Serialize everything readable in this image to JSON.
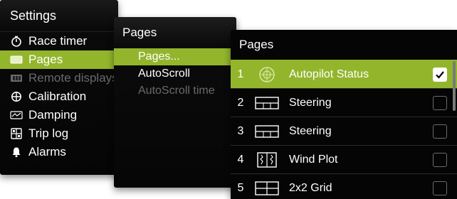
{
  "settings": {
    "title": "Settings",
    "items": [
      {
        "label": "Race timer",
        "icon": "stopwatch-icon"
      },
      {
        "label": "Pages",
        "icon": "pages-icon",
        "selected": true
      },
      {
        "label": "Remote displays",
        "icon": "remote-display-icon",
        "disabled": true
      },
      {
        "label": "Calibration",
        "icon": "calibration-icon"
      },
      {
        "label": "Damping",
        "icon": "damping-icon"
      },
      {
        "label": "Trip log",
        "icon": "trip-log-icon"
      },
      {
        "label": "Alarms",
        "icon": "bell-icon"
      }
    ]
  },
  "pages_menu": {
    "title": "Pages",
    "items": [
      {
        "label": "Pages...",
        "selected": true
      },
      {
        "label": "AutoScroll"
      },
      {
        "label": "AutoScroll time",
        "disabled": true
      }
    ]
  },
  "pages_list": {
    "title": "Pages",
    "rows": [
      {
        "num": "1",
        "name": "Autopilot Status",
        "icon": "autopilot-status-icon",
        "checked": true,
        "selected": true
      },
      {
        "num": "2",
        "name": "Steering",
        "icon": "steering-icon",
        "checked": false
      },
      {
        "num": "3",
        "name": "Steering",
        "icon": "steering-icon",
        "checked": false
      },
      {
        "num": "4",
        "name": "Wind Plot",
        "icon": "wind-plot-icon",
        "checked": false
      },
      {
        "num": "5",
        "name": "2x2 Grid",
        "icon": "grid-2x2-icon",
        "checked": false
      }
    ]
  },
  "colors": {
    "accent": "#93b52c",
    "panel": "#050505",
    "disabled_text": "#6a6a6a"
  }
}
